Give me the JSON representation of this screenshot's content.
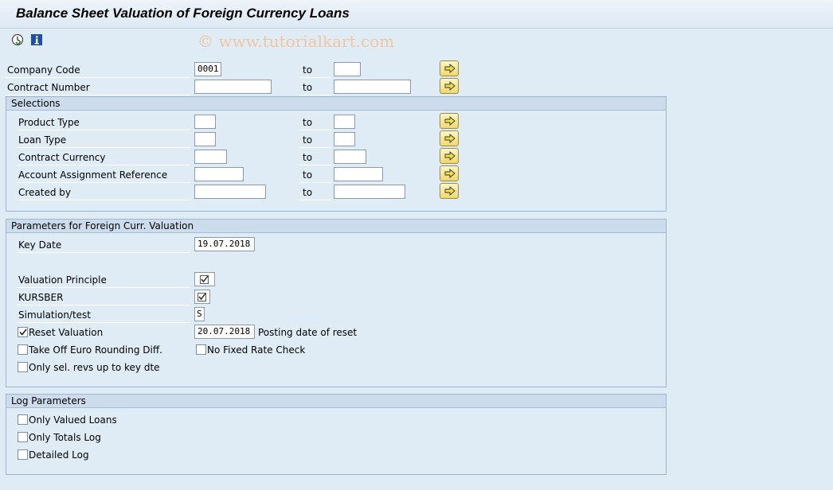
{
  "window": {
    "title": "Balance Sheet Valuation of Foreign Currency Loans"
  },
  "toolbar": {
    "execute_icon": "execute-clock-icon",
    "info_icon": "info-icon"
  },
  "watermark": "© www.tutorialkart.com",
  "to_label": "to",
  "top_fields": {
    "company_code": {
      "label": "Company Code",
      "from": "0001",
      "to": ""
    },
    "contract_number": {
      "label": "Contract Number",
      "from": "",
      "to": ""
    }
  },
  "selections": {
    "title": "Selections",
    "product_type": {
      "label": "Product Type",
      "from": "",
      "to": ""
    },
    "loan_type": {
      "label": "Loan Type",
      "from": "",
      "to": ""
    },
    "contract_currency": {
      "label": "Contract Currency",
      "from": "",
      "to": ""
    },
    "account_assignment_reference": {
      "label": "Account Assignment Reference",
      "from": "",
      "to": ""
    },
    "created_by": {
      "label": "Created by",
      "from": "",
      "to": ""
    }
  },
  "parameters": {
    "title": "Parameters for Foreign Curr. Valuation",
    "key_date": {
      "label": "Key Date",
      "value": "19.07.2018"
    },
    "valuation_principle": {
      "label": "Valuation Principle",
      "checked": true
    },
    "kursber": {
      "label": "KURSBER",
      "checked": true
    },
    "simulation": {
      "label": "Simulation/test",
      "value": "S"
    },
    "reset_valuation": {
      "label": "Reset Valuation",
      "checked": true,
      "date": "20.07.2018",
      "date_label": "Posting date of reset"
    },
    "take_off_euro": {
      "label": "Take Off Euro Rounding Diff.",
      "checked": false
    },
    "no_fixed_rate": {
      "label": "No Fixed Rate Check",
      "checked": false
    },
    "only_sel_revs": {
      "label": "Only sel. revs up to key dte",
      "checked": false
    }
  },
  "log_parameters": {
    "title": "Log Parameters",
    "only_valued_loans": {
      "label": "Only Valued Loans",
      "checked": false
    },
    "only_totals_log": {
      "label": "Only Totals Log",
      "checked": false
    },
    "detailed_log": {
      "label": "Detailed Log",
      "checked": false
    }
  },
  "colors": {
    "background": "#dfebf5",
    "group_header": "#cddced",
    "multiple_selection_button": "#f2d86a"
  }
}
